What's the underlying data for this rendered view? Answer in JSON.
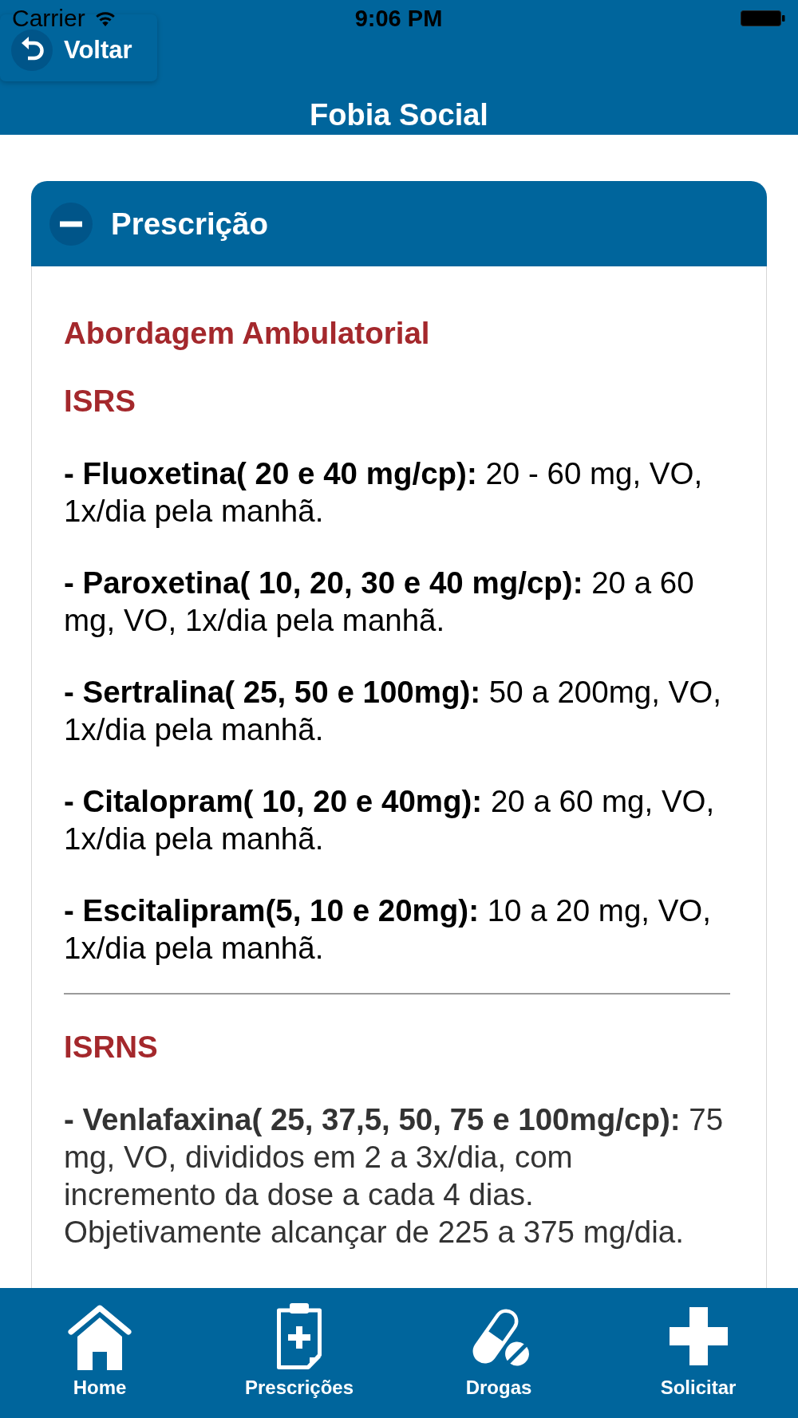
{
  "status_bar": {
    "carrier": "Carrier",
    "time": "9:06 PM"
  },
  "nav_bar": {
    "back_button": "Voltar",
    "title": "Fobia Social"
  },
  "panel": {
    "title": "Prescrição",
    "expanded": true,
    "heading": "Abordagem Ambulatorial",
    "sections": [
      {
        "title": "ISRS",
        "entries": [
          "**- Fluoxetina( 20 e 40 mg/cp):** 20 - 60 mg, VO, 1x/dia pela manhã.",
          "**- Paroxetina( 10, 20, 30 e 40 mg/cp):** 20 a 60 mg, VO, 1x/dia pela manhã.",
          "**- Sertralina( 25, 50 e 100mg):** 50 a 200mg, VO, 1x/dia pela manhã.",
          "**- Citalopram( 10, 20 e 40mg):** 20 a 60 mg, VO, 1x/dia pela manhã.",
          "**- Escitalipram(5, 10 e 20mg):** 10 a 20 mg, VO, 1x/dia pela manhã."
        ]
      },
      {
        "title": "ISRNS",
        "entries": [
          "**- Venlafaxina( 25, 37,5, 50, 75 e 100mg/cp):** 75 mg, VO, divididos em 2 a 3x/dia, com incremento da dose a cada 4 dias. Objetivamente alcançar de 225 a 375 mg/dia."
        ]
      }
    ]
  },
  "tab_bar": {
    "items": [
      {
        "label": "Home",
        "kind": "home"
      },
      {
        "label": "Prescrições",
        "kind": "prescriptions"
      },
      {
        "label": "Drogas",
        "kind": "drugs"
      },
      {
        "label": "Solicitar",
        "kind": "request"
      }
    ]
  }
}
